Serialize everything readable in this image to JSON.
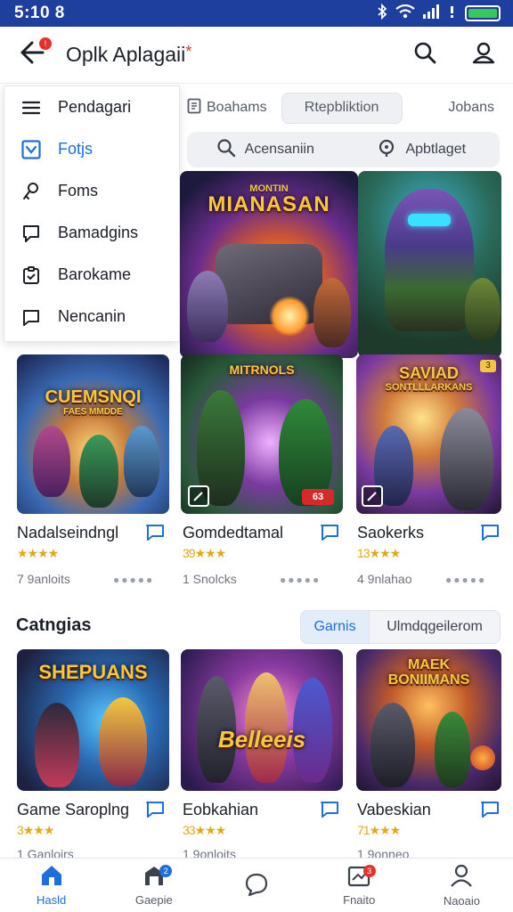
{
  "status_bar": {
    "time": "5:10 8"
  },
  "app_bar": {
    "title": "Oplk Aplagaii",
    "title_mark": "*",
    "back_badge": "!"
  },
  "drawer": {
    "items": [
      {
        "label": "Pendagari",
        "icon": "menu-lines-icon"
      },
      {
        "label": "Fotjs",
        "icon": "checkbox-icon",
        "active": true
      },
      {
        "label": "Foms",
        "icon": "person-key-icon"
      },
      {
        "label": "Bamadgins",
        "icon": "chat-bubble-icon"
      },
      {
        "label": "Barokame",
        "icon": "clipboard-icon"
      },
      {
        "label": "Nencanin",
        "icon": "message-icon"
      }
    ]
  },
  "filters": {
    "tab_left": "Boahams",
    "chip": "Rtepbliktion",
    "tab_right": "Jobans"
  },
  "search": {
    "left": "Acensaniin",
    "right": "Apbtlaget"
  },
  "hero": {
    "title": "MIANASAN",
    "subtitle": "MONTIN"
  },
  "grid_row1": [
    {
      "name": "Nadalseindngl",
      "stars": "★★★★",
      "meta": "7 9anloits",
      "art_title": "CUEMSNQI",
      "art_sub": "FAES MMDDE"
    },
    {
      "name": "Gomdedtamal",
      "stars": "39★★★",
      "meta": "1 Snolcks",
      "art_title": "MITRNOLS",
      "art_badge": "63"
    },
    {
      "name": "Saokerks",
      "stars": "13★★★",
      "meta": "4 9nlahao",
      "art_title": "SAVIAD",
      "art_sub": "SONTLLLARKANS",
      "art_badge": "3"
    }
  ],
  "section": {
    "title": "Catngias",
    "seg_a": "Garnis",
    "seg_b": "Ulmdqgeilerom"
  },
  "grid_row2": [
    {
      "name": "Game Saroplng",
      "stars": "3★★★",
      "meta": "1 Ganloirs",
      "art_title": "SHEPUANS"
    },
    {
      "name": "Eobkahian",
      "stars": "33★★★",
      "meta": "1 9onloits",
      "art_title": "Belleeis"
    },
    {
      "name": "Vabeskian",
      "stars": "71★★★",
      "meta": "1 9onneo",
      "art_title": "MAEK BONIIMANS"
    }
  ],
  "bottom_nav": [
    {
      "label": "Hasld",
      "icon": "home-icon",
      "active": true
    },
    {
      "label": "Gaepie",
      "icon": "games-icon",
      "badge": "2"
    },
    {
      "label": "",
      "icon": "chat-icon"
    },
    {
      "label": "Fnaito",
      "icon": "inbox-icon",
      "badge": "3"
    },
    {
      "label": "Naoaio",
      "icon": "profile-icon"
    }
  ],
  "colors": {
    "accent": "#1e6fd9",
    "status_bar": "#1f3f9e",
    "badge": "#e3322b",
    "star": "#e2a81c"
  }
}
